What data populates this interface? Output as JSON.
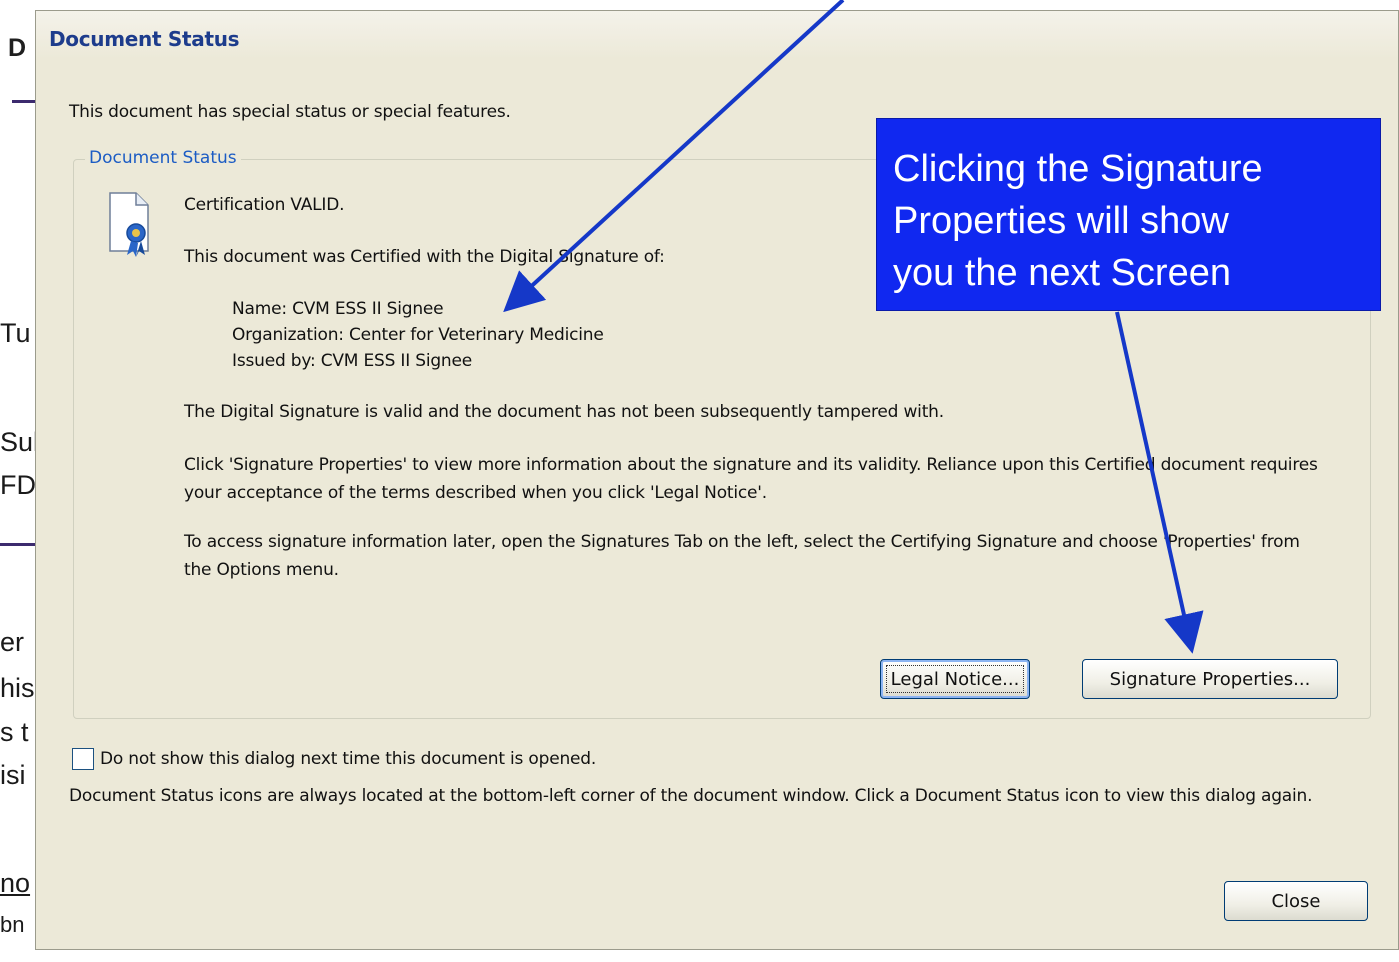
{
  "background_slide": {
    "fragments": [
      "D",
      "Tu",
      "Sul",
      "FD",
      "er",
      "his",
      "s t",
      "isi",
      "no",
      "bn"
    ]
  },
  "dialog": {
    "title": "Document Status",
    "intro": "This document has special status or special features.",
    "group_label": "Document Status",
    "status_line": "Certification VALID.",
    "certified_by_line": "This document was Certified with the Digital Signature of:",
    "signer": {
      "name": "Name: CVM ESS II Signee",
      "organization": "Organization: Center for Veterinary Medicine",
      "issued_by": "Issued by: CVM ESS II Signee"
    },
    "valid_message": "The Digital Signature is valid and the document has not been subsequently tampered with.",
    "properties_message": "Click 'Signature Properties' to view more information about the signature and its validity. Reliance upon this Certified document requires your acceptance of the terms described when you click 'Legal Notice'.",
    "access_message": "To access signature information later, open the Signatures Tab on the left, select the Certifying Signature and choose 'Properties' from the Options menu.",
    "legal_notice_button": "Legal Notice...",
    "signature_properties_button": "Signature Properties...",
    "checkbox_label": "Do not show this dialog next time this document is opened.",
    "checkbox_checked": false,
    "footer_message": "Document Status icons are always located at the bottom-left corner of the document window. Click a Document Status icon to view this dialog again.",
    "close_button": "Close"
  },
  "callout": {
    "text": "Clicking the Signature\nProperties will show\nyou the next Screen",
    "color": "#1028f0"
  },
  "colors": {
    "dialog_bg": "#ece9d8",
    "title_text": "#1d3c8c",
    "group_label": "#1c5cc4",
    "arrow": "#1538c8"
  },
  "icons": [
    "certificate-ribbon-icon"
  ]
}
